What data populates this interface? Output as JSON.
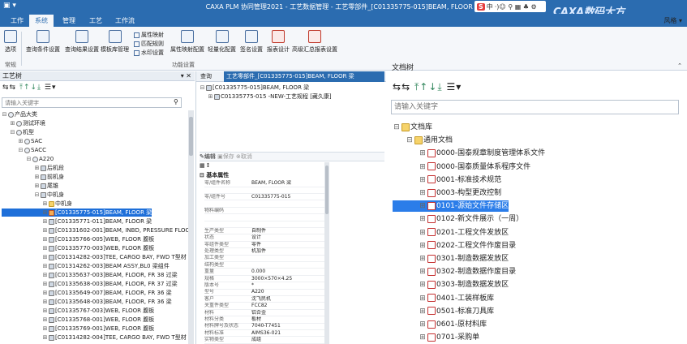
{
  "titlebar": {
    "title": "CAXA PLM 协同管理2021 - 工艺数据管理 - 工艺零部件_[C01335775-015]BEAM, FLOOR 梁",
    "watermark": "CAXA数码大方",
    "ime_label": "中",
    "window_label": "风格"
  },
  "menu": [
    "工作",
    "系统",
    "管理",
    "工艺",
    "工作流"
  ],
  "menu_active": 1,
  "ribbon": {
    "buttons": [
      {
        "label": "选项",
        "icon": "options-icon"
      },
      {
        "label": "查询条件设置",
        "icon": "query-condition-icon"
      },
      {
        "label": "查询结果设置",
        "icon": "query-result-icon"
      },
      {
        "label": "模板库管理",
        "icon": "template-library-icon"
      },
      {
        "label": "属性映射配置",
        "icon": "attr-mapping-icon"
      },
      {
        "label": "轻量化配置",
        "icon": "lightweight-icon"
      },
      {
        "label": "签名设置",
        "icon": "signature-icon"
      },
      {
        "label": "报表设计",
        "icon": "report-design-icon"
      },
      {
        "label": "高级汇总报表设置",
        "icon": "summary-report-icon"
      }
    ],
    "small": [
      "属性映射",
      "匹配规则",
      "水印设置"
    ],
    "groups": [
      "常规",
      "功能设置"
    ]
  },
  "left_panel": {
    "title": "工艺树",
    "pin": "▾ ✕",
    "search_placeholder": "请输入关键字",
    "tree": [
      {
        "level": 0,
        "exp": "⊟",
        "icon": "org",
        "text": "产品大类"
      },
      {
        "level": 1,
        "exp": "⊞",
        "icon": "org",
        "text": "测试环境"
      },
      {
        "level": 1,
        "exp": "⊟",
        "icon": "org",
        "text": "机型"
      },
      {
        "level": 2,
        "exp": "⊞",
        "icon": "org",
        "text": "SAC"
      },
      {
        "level": 2,
        "exp": "⊟",
        "icon": "org",
        "text": "SACC"
      },
      {
        "level": 3,
        "exp": "⊟",
        "icon": "org",
        "text": "A220"
      },
      {
        "level": 4,
        "exp": "⊞",
        "icon": "part",
        "text": "后机段"
      },
      {
        "level": 4,
        "exp": "⊞",
        "icon": "part",
        "text": "前机身"
      },
      {
        "level": 4,
        "exp": "⊞",
        "icon": "part",
        "text": "尾锥"
      },
      {
        "level": 4,
        "exp": "⊟",
        "icon": "part",
        "text": "中机身"
      },
      {
        "level": 5,
        "exp": "⊞",
        "icon": "folder",
        "text": "中机身"
      },
      {
        "level": 5,
        "exp": "⊞",
        "icon": "orange",
        "text": "[C01335775-015]BEAM, FLOOR 梁",
        "selected": true
      },
      {
        "level": 5,
        "exp": "⊞",
        "icon": "part",
        "text": "[C01335771-011]BEAM, FLOOR 梁"
      },
      {
        "level": 5,
        "exp": "⊞",
        "icon": "part",
        "text": "[C01331602-001]BEAM, INBD, PRESSURE FLOOR"
      },
      {
        "level": 5,
        "exp": "⊞",
        "icon": "part",
        "text": "[C01335766-005]WEB, FLOOR 腹板"
      },
      {
        "level": 5,
        "exp": "⊞",
        "icon": "part",
        "text": "[C01335770-003]WEB, FLOOR 腹板"
      },
      {
        "level": 5,
        "exp": "⊞",
        "icon": "part",
        "text": "[C01314282-003]TEE, CARGO BAY, FWD T型材"
      },
      {
        "level": 5,
        "exp": "⊞",
        "icon": "part",
        "text": "[C01314262-003]BEAM ASSY,BL0 梁组件"
      },
      {
        "level": 5,
        "exp": "⊞",
        "icon": "part",
        "text": "[C01335637-003]BEAM, FLOOR, FR 38 过梁"
      },
      {
        "level": 5,
        "exp": "⊞",
        "icon": "part",
        "text": "[C01335638-003]BEAM, FLOOR, FR 37 过梁"
      },
      {
        "level": 5,
        "exp": "⊞",
        "icon": "part",
        "text": "[C01335649-007]BEAM, FLOOR, FR 36 梁"
      },
      {
        "level": 5,
        "exp": "⊞",
        "icon": "part",
        "text": "[C01335648-003]BEAM, FLOOR, FR 36 梁"
      },
      {
        "level": 5,
        "exp": "⊞",
        "icon": "part",
        "text": "[C01335767-003]WEB, FLOOR 腹板"
      },
      {
        "level": 5,
        "exp": "⊞",
        "icon": "part",
        "text": "[C01335768-001]WEB, FLOOR 腹板"
      },
      {
        "level": 5,
        "exp": "⊞",
        "icon": "part",
        "text": "[C01335769-001]WEB, FLOOR 腹板"
      },
      {
        "level": 5,
        "exp": "⊞",
        "icon": "part",
        "text": "[C01314282-004]TEE, CARGO BAY, FWD T型材"
      }
    ]
  },
  "middle_panel": {
    "tabs": [
      "查询",
      "工艺零部件_[C01335775-015]BEAM, FLOOR 梁"
    ],
    "active_tab": 1,
    "tree": [
      {
        "exp": "⊟",
        "text": "[C01335775-015]BEAM, FLOOR 梁"
      },
      {
        "exp": "⊞",
        "text": "C01335775-015 -NEW-工艺规程 [藏久康]"
      }
    ],
    "actions": [
      "编辑",
      "保存",
      "取消"
    ],
    "section_title": "基本属性",
    "properties": [
      {
        "k": "零/组件名称",
        "v": "BEAM, FLOOR 梁"
      },
      {
        "k": "",
        "v": ""
      },
      {
        "k": "零/组件号",
        "v": "C01335775-015"
      },
      {
        "k": "",
        "v": ""
      },
      {
        "k": "物料编码",
        "v": ""
      },
      {
        "k": "",
        "v": ""
      },
      {
        "k": "",
        "v": ""
      },
      {
        "k": "生产类型",
        "v": "自制件"
      },
      {
        "k": "状态",
        "v": "设计"
      },
      {
        "k": "零组件类型",
        "v": "零件"
      },
      {
        "k": "处理类型",
        "v": "机加件"
      },
      {
        "k": "加工类型",
        "v": ""
      },
      {
        "k": "结构类型",
        "v": ""
      },
      {
        "k": "重量",
        "v": "0.000"
      },
      {
        "k": "规格",
        "v": "3000×570×4.25"
      },
      {
        "k": "版本号",
        "v": "*"
      },
      {
        "k": "型号",
        "v": "A220"
      },
      {
        "k": "客户",
        "v": "沈飞民机"
      },
      {
        "k": "关重件类型",
        "v": "FCC82"
      },
      {
        "k": "材料",
        "v": "铝合金"
      },
      {
        "k": "材料分类",
        "v": "板材"
      },
      {
        "k": "材料牌号及状态",
        "v": "7040-T7451"
      },
      {
        "k": "材料标准",
        "v": "AIMS36-021"
      },
      {
        "k": "实物类型",
        "v": "成组"
      }
    ]
  },
  "right_panel": {
    "title": "文档树",
    "search_placeholder": "请输入关键字",
    "tree": [
      {
        "level": 0,
        "exp": "⊟",
        "icon": "folder",
        "text": "文档库"
      },
      {
        "level": 1,
        "exp": "⊟",
        "icon": "folder",
        "text": "通用文档"
      },
      {
        "level": 2,
        "exp": "⊞",
        "icon": "doc",
        "text": "0000-国泰规章制度管理体系文件"
      },
      {
        "level": 2,
        "exp": "⊞",
        "icon": "doc",
        "text": "0000-国泰质量体系程序文件"
      },
      {
        "level": 2,
        "exp": "⊞",
        "icon": "doc",
        "text": "0001-标准技术规范"
      },
      {
        "level": 2,
        "exp": "⊞",
        "icon": "doc",
        "text": "0003-构型更改控制"
      },
      {
        "level": 2,
        "exp": "⊞",
        "icon": "doc",
        "text": "0101-源始文件存储区",
        "selected": true
      },
      {
        "level": 2,
        "exp": "⊞",
        "icon": "doc",
        "text": "0102-新文件展示（一周）"
      },
      {
        "level": 2,
        "exp": "⊞",
        "icon": "doc",
        "text": "0201-工程文件发放区"
      },
      {
        "level": 2,
        "exp": "⊞",
        "icon": "doc",
        "text": "0202-工程文件作废目录"
      },
      {
        "level": 2,
        "exp": "⊞",
        "icon": "doc",
        "text": "0301-制造数据发放区"
      },
      {
        "level": 2,
        "exp": "⊞",
        "icon": "doc",
        "text": "0302-制造数据作废目录"
      },
      {
        "level": 2,
        "exp": "⊞",
        "icon": "doc",
        "text": "0303-制造数据发放区"
      },
      {
        "level": 2,
        "exp": "⊞",
        "icon": "doc",
        "text": "0401-工装样板库"
      },
      {
        "level": 2,
        "exp": "⊞",
        "icon": "doc",
        "text": "0501-标准刀具库"
      },
      {
        "level": 2,
        "exp": "⊞",
        "icon": "doc",
        "text": "0601-原材料库"
      },
      {
        "level": 2,
        "exp": "⊞",
        "icon": "doc",
        "text": "0701-采购单"
      }
    ]
  },
  "colors": {
    "accent": "#2b6cb0",
    "selection": "#1e6fd9"
  }
}
